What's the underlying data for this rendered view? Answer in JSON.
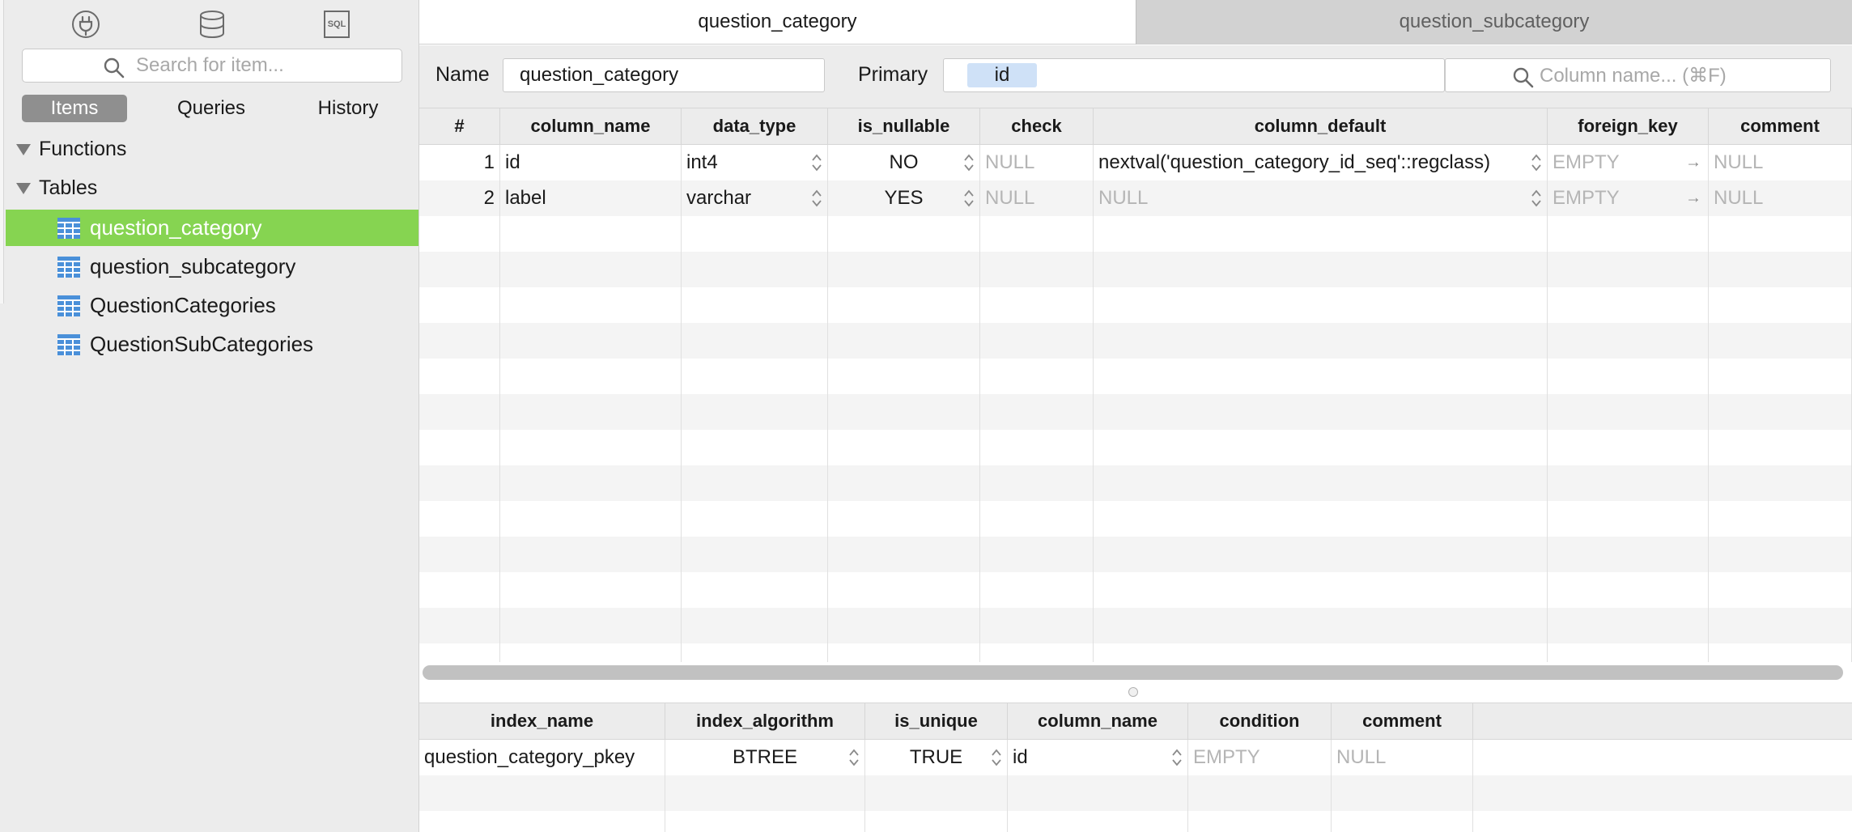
{
  "sidebar": {
    "top_icons": [
      "plug-icon",
      "database-icon",
      "sql-icon"
    ],
    "sql_icon_text": "SQL",
    "search_placeholder": "Search for item...",
    "tabs": [
      {
        "label": "Items",
        "active": true
      },
      {
        "label": "Queries",
        "active": false
      },
      {
        "label": "History",
        "active": false
      }
    ],
    "sections": [
      {
        "label": "Functions",
        "expanded": true
      },
      {
        "label": "Tables",
        "expanded": true
      }
    ],
    "tables": [
      {
        "label": "question_category",
        "selected": true
      },
      {
        "label": "question_subcategory",
        "selected": false
      },
      {
        "label": "QuestionCategories",
        "selected": false
      },
      {
        "label": "QuestionSubCategories",
        "selected": false
      }
    ]
  },
  "tabs": [
    {
      "label": "question_category",
      "active": true
    },
    {
      "label": "question_subcategory",
      "active": false
    }
  ],
  "structure": {
    "name_label": "Name",
    "name_value": "question_category",
    "primary_label": "Primary",
    "primary_value": "id",
    "column_search_placeholder": "Column name... (⌘F)"
  },
  "columns_table": {
    "headers": [
      "#",
      "column_name",
      "data_type",
      "is_nullable",
      "check",
      "column_default",
      "foreign_key",
      "comment"
    ],
    "rows": [
      {
        "num": "1",
        "column_name": "id",
        "data_type": "int4",
        "is_nullable": "NO",
        "check": "NULL",
        "column_default": "nextval('question_category_id_seq'::regclass)",
        "foreign_key": "EMPTY",
        "comment": "NULL"
      },
      {
        "num": "2",
        "column_name": "label",
        "data_type": "varchar",
        "is_nullable": "YES",
        "check": "NULL",
        "column_default": "NULL",
        "foreign_key": "EMPTY",
        "comment": "NULL"
      }
    ]
  },
  "index_table": {
    "headers": [
      "index_name",
      "index_algorithm",
      "is_unique",
      "column_name",
      "condition",
      "comment"
    ],
    "rows": [
      {
        "index_name": "question_category_pkey",
        "index_algorithm": "BTREE",
        "is_unique": "TRUE",
        "column_name": "id",
        "condition": "EMPTY",
        "comment": "NULL"
      }
    ]
  },
  "colors": {
    "selection": "#86d451",
    "active_segment": "#8f8f8f",
    "primary_chip": "#cfe1f7",
    "table_icon": "#4a90d9"
  }
}
